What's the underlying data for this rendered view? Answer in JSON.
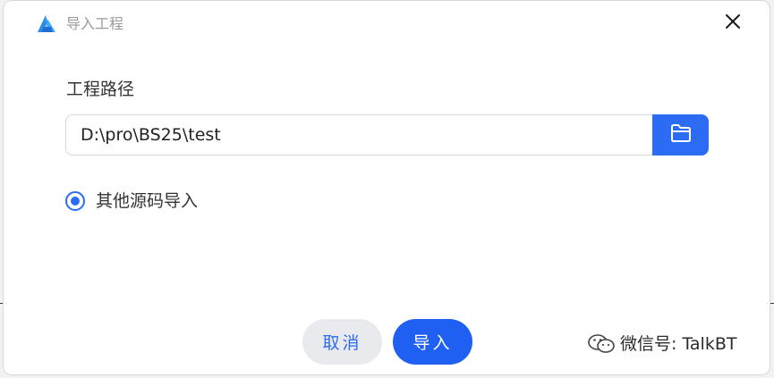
{
  "window": {
    "title": "导入工程"
  },
  "form": {
    "path_label": "工程路径",
    "path_value": "D:\\pro\\BS25\\test"
  },
  "option": {
    "label": "其他源码导入",
    "checked": true
  },
  "footer": {
    "cancel_label": "取消",
    "import_label": "导入"
  },
  "watermark": {
    "text": "微信号: TalkBT"
  },
  "icons": {
    "logo": "app-logo-icon",
    "close": "close-icon",
    "browse": "folder-icon",
    "watermark": "wechat-icon"
  },
  "colors": {
    "accent": "#2c6cf5",
    "primary_button": "#1f5ff2",
    "secondary_button": "#e9eaee",
    "title_text": "#9a9a9a"
  }
}
